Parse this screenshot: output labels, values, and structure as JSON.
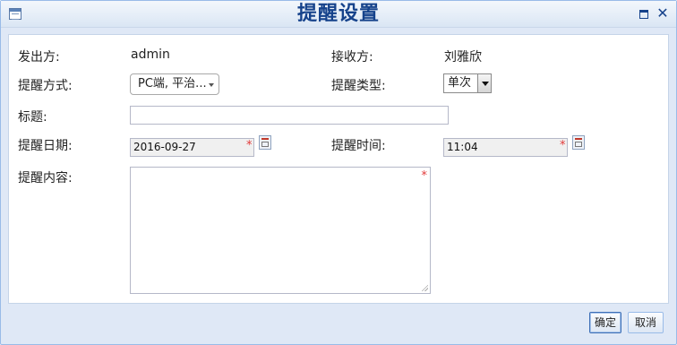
{
  "window": {
    "title": "提醒设置",
    "icons": {
      "app": "form-icon",
      "maximize": "maximize-icon",
      "close": "close-icon"
    }
  },
  "form": {
    "sender_label": "发出方:",
    "sender_value": "admin",
    "receiver_label": "接收方:",
    "receiver_value": "刘雅欣",
    "method_label": "提醒方式:",
    "method_value": "PC端, 平治...",
    "type_label": "提醒类型:",
    "type_value": "单次",
    "subject_label": "标题:",
    "subject_value": "",
    "date_label": "提醒日期:",
    "date_value": "2016-09-27",
    "time_label": "提醒时间:",
    "time_value": "11:04",
    "content_label": "提醒内容:",
    "content_value": "",
    "required_mark": "*"
  },
  "buttons": {
    "ok": "确定",
    "cancel": "取消"
  },
  "colors": {
    "title": "#15428b",
    "frame": "#dfe8f6",
    "required": "#e23a3a"
  }
}
